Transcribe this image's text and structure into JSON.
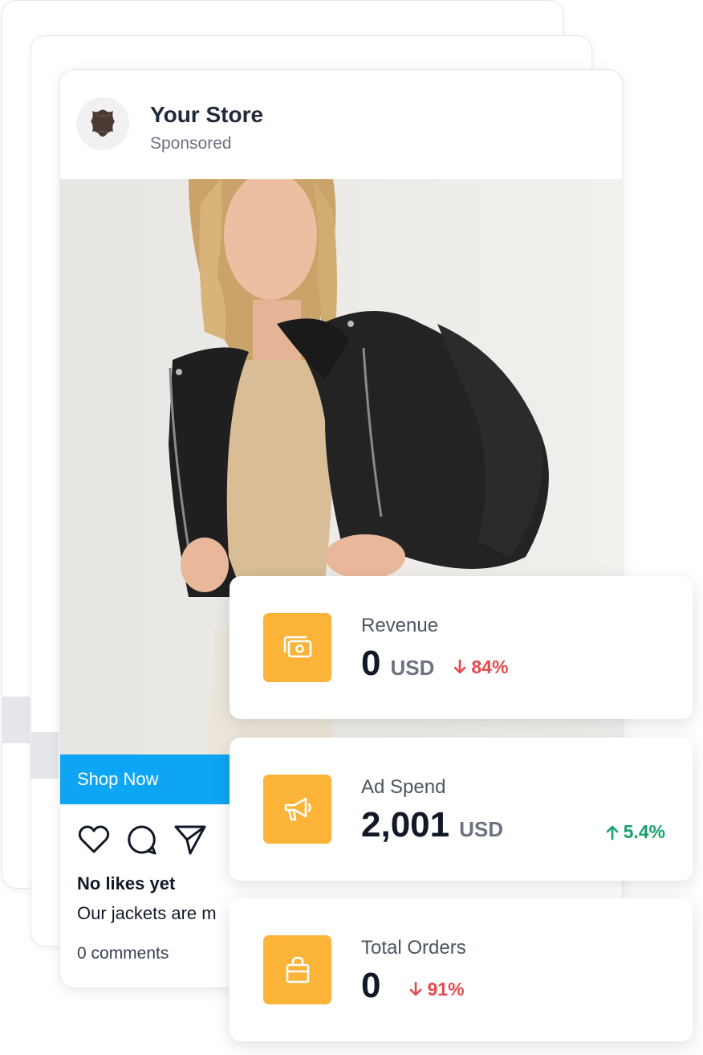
{
  "post": {
    "store_name": "Your Store",
    "sponsored_label": "Sponsored",
    "cta_label": "Shop Now",
    "likes_text": "No likes yet",
    "caption": "Our jackets are m",
    "comments_text": "0 comments"
  },
  "metrics": [
    {
      "label": "Revenue",
      "value": "0",
      "unit": "USD",
      "change": "84%",
      "direction": "down",
      "icon": "money-icon"
    },
    {
      "label": "Ad Spend",
      "value": "2,001",
      "unit": "USD",
      "change": "5.4%",
      "direction": "up",
      "icon": "megaphone-icon"
    },
    {
      "label": "Total Orders",
      "value": "0",
      "unit": "",
      "change": "91%",
      "direction": "down",
      "icon": "shopping-bag-icon"
    }
  ],
  "colors": {
    "accent": "#fbb338",
    "cta": "#0ea5f4",
    "negative": "#e5484d",
    "positive": "#16a36a"
  }
}
